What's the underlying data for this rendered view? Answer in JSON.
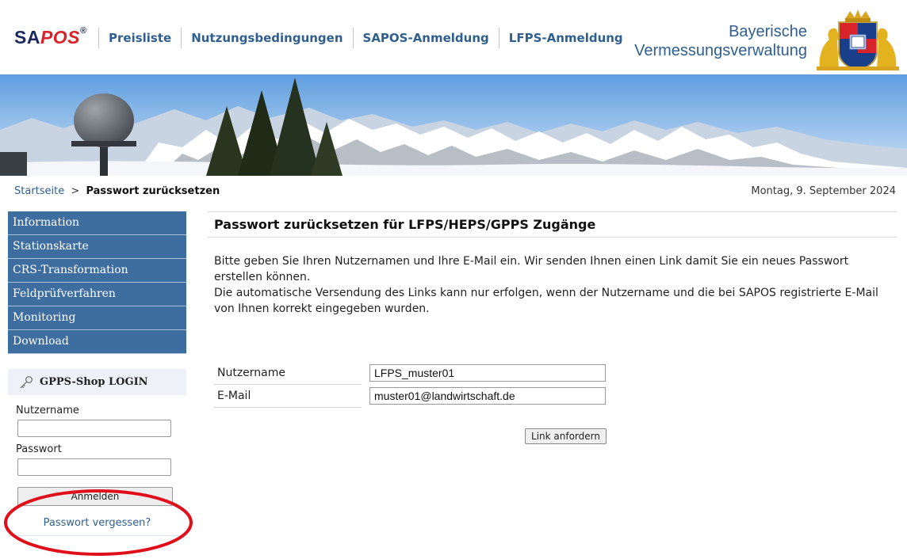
{
  "header": {
    "logo_sa": "SA",
    "logo_pos": "POS",
    "logo_reg": "®",
    "nav": [
      "Preisliste",
      "Nutzungsbedingungen",
      "SAPOS-Anmeldung",
      "LFPS-Anmeldung"
    ],
    "brand_line1": "Bayerische",
    "brand_line2": "Vermessungsverwaltung"
  },
  "breadcrumb": {
    "home": "Startseite",
    "separator": ">",
    "current": "Passwort zurücksetzen"
  },
  "date": "Montag, 9. September 2024",
  "sidebar": {
    "items": [
      {
        "label": "Information"
      },
      {
        "label": "Stationskarte"
      },
      {
        "label": "CRS-Transformation"
      },
      {
        "label": "Feldprüfverfahren"
      },
      {
        "label": "Monitoring"
      },
      {
        "label": "Download"
      }
    ]
  },
  "login": {
    "title": "GPPS-Shop LOGIN",
    "username_label": "Nutzername",
    "username_value": "",
    "password_label": "Passwort",
    "password_value": "",
    "button_label": "Anmelden",
    "forgot_link": "Passwort vergessen?"
  },
  "main": {
    "title": "Passwort zurücksetzen für LFPS/HEPS/GPPS Zugänge",
    "intro_line1": "Bitte geben Sie Ihren Nutzernamen und Ihre E-Mail ein. Wir senden Ihnen einen Link damit Sie ein neues Passwort erstellen können.",
    "intro_line2": "Die automatische Versendung des Links kann nur erfolgen, wenn der Nutzername und die bei SAPOS registrierte E-Mail von Ihnen korrekt eingegeben wurden.",
    "form": {
      "username_label": "Nutzername",
      "username_value": "LFPS_muster01",
      "email_label": "E-Mail",
      "email_value": "muster01@landwirtschaft.de"
    },
    "submit_label": "Link anfordern"
  },
  "colors": {
    "menu_bg": "#3e6d9f",
    "link": "#2f5f8f",
    "logo_red": "#d8232a",
    "logo_navy": "#1a2a5e",
    "annotation": "#e0101a"
  }
}
